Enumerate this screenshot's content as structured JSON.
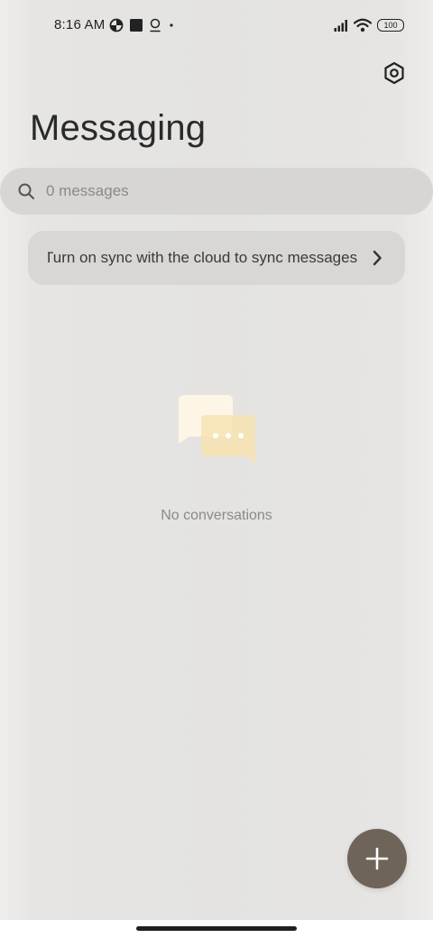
{
  "status_bar": {
    "time": "8:16 AM",
    "battery_level": "100",
    "left_icons": [
      "data-saver-icon",
      "square-notification-icon",
      "location-pin-icon",
      "dot-icon"
    ],
    "right_icons": [
      "signal-icon",
      "wifi-icon",
      "battery-icon"
    ]
  },
  "header": {
    "title": "Messaging",
    "settings_icon": "hexagon-gear-icon"
  },
  "search": {
    "placeholder": "0 messages",
    "value": ""
  },
  "sync_banner": {
    "text": "Turn on sync with the cloud to sync messages"
  },
  "empty_state": {
    "text": "No conversations",
    "illustration": "chat-bubbles-icon"
  },
  "fab": {
    "icon": "plus-icon"
  },
  "colors": {
    "background": "#e4e3e1",
    "search_bg": "#d7d6d4",
    "banner_bg": "#d8d7d5",
    "fab_bg": "#6f645a",
    "bubble_back": "#fdf6e6",
    "bubble_front": "#f7e3b2"
  }
}
